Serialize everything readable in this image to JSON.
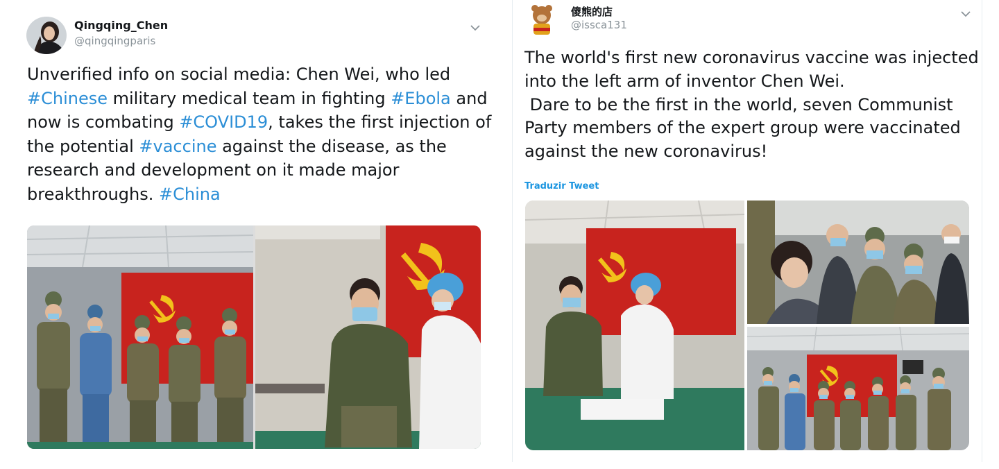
{
  "left_tweet": {
    "author_name": "Qingqing_Chen",
    "author_handle": "@qingqingparis",
    "lines": [
      [
        {
          "t": "Unverified info on social media: Chen Wei, who led"
        }
      ],
      [
        {
          "t": "#Chinese",
          "tag": true
        },
        {
          "t": " military medical team in fighting "
        },
        {
          "t": "#Ebola",
          "tag": true
        },
        {
          "t": " and"
        }
      ],
      [
        {
          "t": "now is combating "
        },
        {
          "t": "#COVID19",
          "tag": true
        },
        {
          "t": ", takes the first injection of"
        }
      ],
      [
        {
          "t": "the potential "
        },
        {
          "t": "#vaccine",
          "tag": true
        },
        {
          "t": " against the disease, as the"
        }
      ],
      [
        {
          "t": "research and development on it made major"
        }
      ],
      [
        {
          "t": "breakthroughs. "
        },
        {
          "t": "#China",
          "tag": true
        }
      ]
    ]
  },
  "right_tweet": {
    "author_name": "傻熊的店",
    "author_handle": "@issca131",
    "lines": [
      "The world's first new coronavirus vaccine was injected",
      "into the left arm of inventor Chen Wei.",
      " Dare to be the first in the world, seven Communist",
      "Party members of the expert group were vaccinated",
      "against the new coronavirus!"
    ],
    "translate_label": "Traduzir Tweet"
  },
  "colors": {
    "hashtag": "#2b8ed6",
    "link": "#1b95e0",
    "flag_red": "#c8231e",
    "flag_gold": "#f2c21b"
  },
  "icons": [
    "chevron-down-icon"
  ]
}
